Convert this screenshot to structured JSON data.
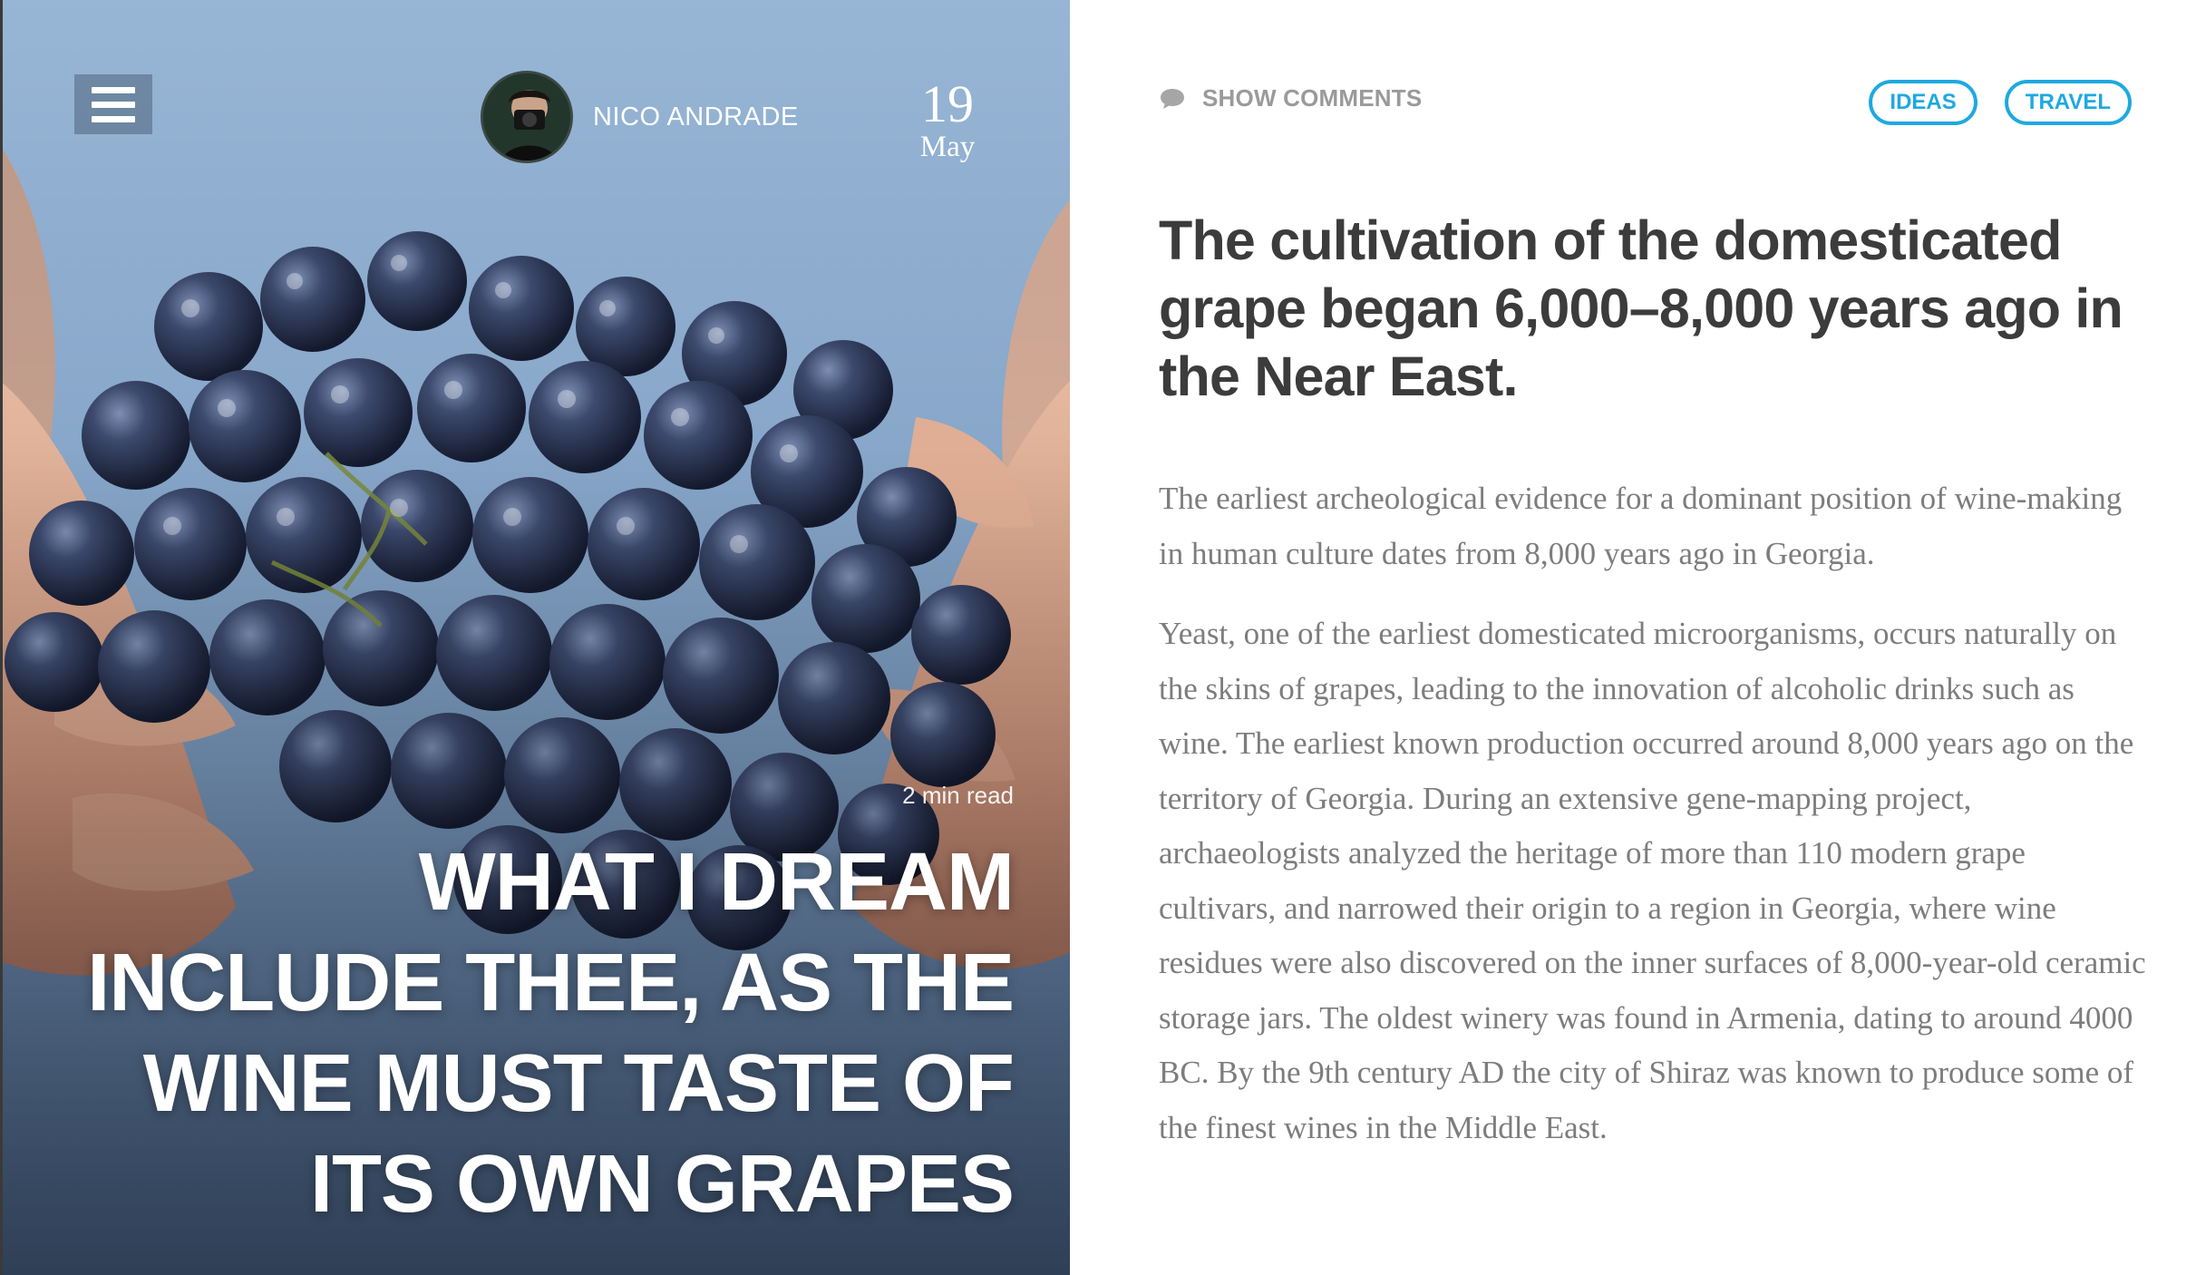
{
  "hero": {
    "author_name": "NICO ANDRADE",
    "date_day": "19",
    "date_month": "May",
    "read_time": "2 min read",
    "title": "WHAT I DREAM INCLUDE THEE, AS THE WINE MUST TASTE OF ITS OWN GRAPES"
  },
  "toolbar": {
    "menu_icon": "hamburger-menu-icon",
    "comments_icon": "speech-bubble-icon",
    "comments_label": "SHOW COMMENTS",
    "tags": [
      "IDEAS",
      "TRAVEL"
    ]
  },
  "article": {
    "title": "The cultivation of the domesticated grape began 6,000–8,000 years ago in the Near East.",
    "paragraphs": [
      "The earliest archeological evidence for a dominant position of wine-making in human culture dates from 8,000 years ago in Georgia.",
      "Yeast, one of the earliest domesticated microorganisms, occurs naturally on the skins of grapes, leading to the innovation of alcoholic drinks such as wine. The earliest known production occurred around 8,000 years ago on the territory of Georgia. During an extensive gene-mapping project, archaeologists analyzed the heritage of more than 110 modern grape cultivars, and narrowed their origin to a region in Georgia, where wine residues were also discovered on the inner surfaces of 8,000-year-old ceramic storage jars. The oldest winery was found in Armenia, dating to around 4000 BC. By the 9th century AD the city of Shiraz was known to produce some of the finest wines in the Middle East."
    ]
  },
  "colors": {
    "accent": "#1fa9e0",
    "title_text": "#3c3c3c",
    "body_text": "#7d7d7d",
    "muted_text": "#9a9a9a"
  }
}
